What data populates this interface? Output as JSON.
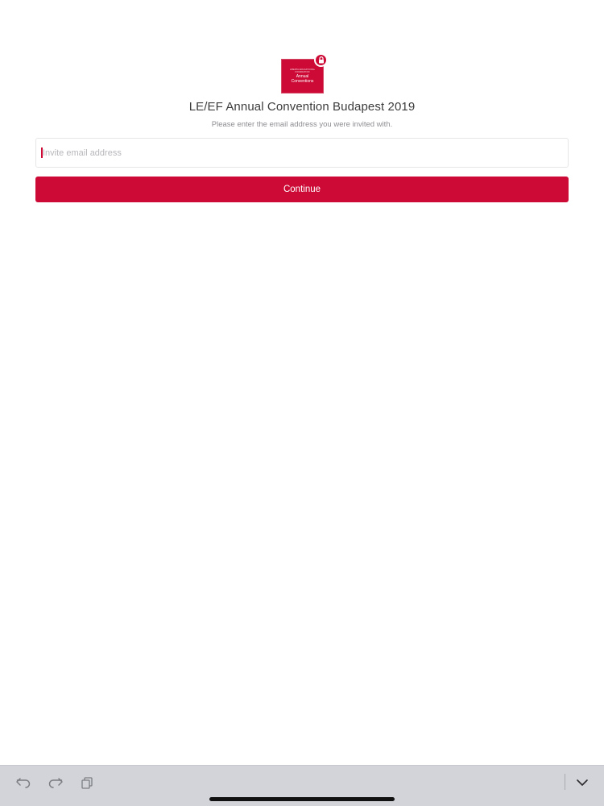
{
  "logo": {
    "small_text": "LIBERTA EDUCATIONAL FOUNDATION",
    "main_text_line1": "Annual",
    "main_text_line2": "Conventions",
    "brand_color": "#cc0a35",
    "badge_icon": "lock-icon"
  },
  "header": {
    "title": "LE/EF Annual Convention Budapest 2019",
    "subtitle": "Please enter the email address you were invited with."
  },
  "form": {
    "email_value": "",
    "email_placeholder": "Invite email address",
    "continue_label": "Continue",
    "accent_color": "#cc0a35"
  },
  "keyboard_toolbar": {
    "icons": [
      "undo-icon",
      "redo-icon",
      "paste-icon",
      "dismiss-keyboard-icon"
    ],
    "background": "#d2d4d9"
  }
}
